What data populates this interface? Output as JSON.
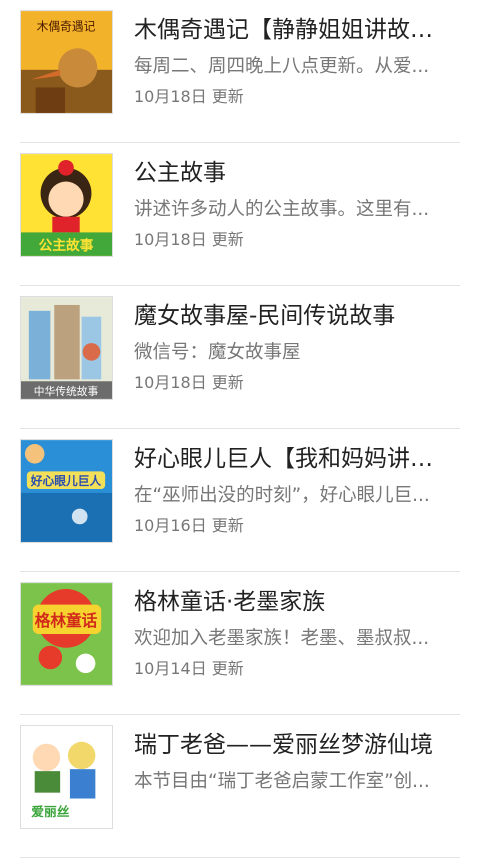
{
  "items": [
    {
      "title": "木偶奇遇记【静静姐姐讲故事】",
      "desc": "每周二、周四晚上八点更新。从爱...",
      "date": "10月18日 更新",
      "thumb_text": "木偶奇遇记"
    },
    {
      "title": "公主故事",
      "desc": "讲述许多动人的公主故事。这里有...",
      "date": "10月18日 更新",
      "thumb_text": "公主故事"
    },
    {
      "title": "魔女故事屋-民间传说故事",
      "desc": "微信号：魔女故事屋",
      "date": "10月18日 更新",
      "thumb_text": "中华传统故事"
    },
    {
      "title": "好心眼儿巨人【我和妈妈讲故...",
      "desc": "在“巫师出没的时刻”，好心眼儿巨...",
      "date": "10月16日 更新",
      "thumb_text": "好心眼儿巨人"
    },
    {
      "title": "格林童话·老墨家族",
      "desc": "欢迎加入老墨家族！老墨、墨叔叔...",
      "date": "10月14日 更新",
      "thumb_text": "格林童话"
    },
    {
      "title": "瑞丁老爸——爱丽丝梦游仙境",
      "desc": "本节目由“瑞丁老爸启蒙工作室”创...",
      "date": "",
      "thumb_text": "爱丽丝"
    }
  ]
}
